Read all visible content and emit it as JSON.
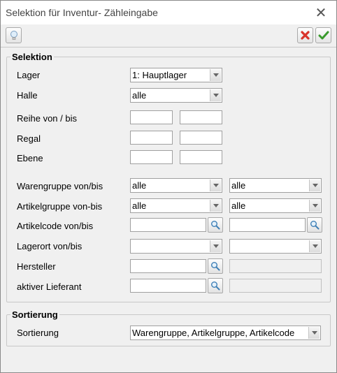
{
  "window": {
    "title": "Selektion für Inventur- Zähleingabe"
  },
  "toolbar": {
    "hint_icon": "lightbulb-icon",
    "cancel_icon": "red-x-icon",
    "ok_icon": "green-check-icon"
  },
  "selektion": {
    "title": "Selektion",
    "lager": {
      "label": "Lager",
      "value": "1: Hauptlager"
    },
    "halle": {
      "label": "Halle",
      "value": "alle"
    },
    "reihe": {
      "label": "Reihe von / bis",
      "from": "",
      "to": ""
    },
    "regal": {
      "label": "Regal",
      "from": "",
      "to": ""
    },
    "ebene": {
      "label": "Ebene",
      "from": "",
      "to": ""
    },
    "warengruppe": {
      "label": "Warengruppe von/bis",
      "from": "alle",
      "to": "alle"
    },
    "artikelgruppe": {
      "label": "Artikelgruppe von-bis",
      "from": "alle",
      "to": "alle"
    },
    "artikelcode": {
      "label": "Artikelcode von/bis",
      "from": "",
      "to": ""
    },
    "lagerort": {
      "label": "Lagerort von/bis",
      "from": "",
      "to": ""
    },
    "hersteller": {
      "label": "Hersteller",
      "value": "",
      "name": ""
    },
    "lieferant": {
      "label": "aktiver Lieferant",
      "value": "",
      "name": ""
    }
  },
  "sortierung": {
    "title": "Sortierung",
    "label": "Sortierung",
    "value": "Warengruppe, Artikelgruppe, Artikelcode"
  },
  "colors": {
    "cancel": "#d9342b",
    "ok": "#3a9a2c"
  }
}
